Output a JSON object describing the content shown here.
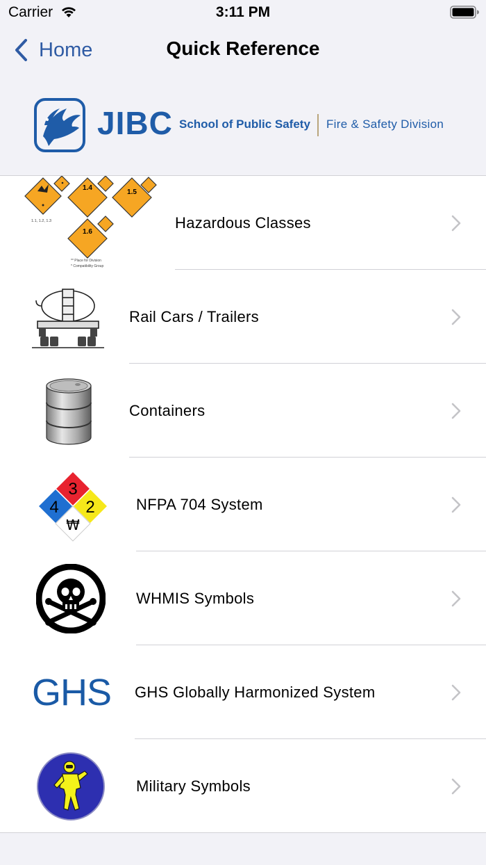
{
  "status_bar": {
    "carrier": "Carrier",
    "time": "3:11 PM"
  },
  "nav": {
    "back_label": "Home",
    "title": "Quick Reference"
  },
  "banner": {
    "logo_word": "JIBC",
    "school": "School of Public Safety",
    "division": "Fire & Safety Division"
  },
  "list": {
    "items": [
      {
        "label": "Hazardous Classes",
        "thumbnail": "explosive-placards",
        "thumb_text": {
          "p14": "1.4",
          "p15": "1.5",
          "p16": "1.6",
          "group": "1.1, 1.2, 1.3",
          "note1": "** Place for Division",
          "note2": "* Compatibility Group"
        }
      },
      {
        "label": "Rail Cars / Trailers",
        "thumbnail": "tank-trailer"
      },
      {
        "label": "Containers",
        "thumbnail": "steel-drum"
      },
      {
        "label": "NFPA 704 System",
        "thumbnail": "nfpa-diamond",
        "thumb_text": {
          "health": "4",
          "flammability": "3",
          "instability": "2",
          "special": "₩"
        }
      },
      {
        "label": "WHMIS Symbols",
        "thumbnail": "skull-crossbones"
      },
      {
        "label": "GHS Globally Harmonized System",
        "thumbnail": "ghs-text",
        "thumb_text": {
          "ghs": "GHS"
        }
      },
      {
        "label": "Military Symbols",
        "thumbnail": "hazmat-suit-person"
      }
    ]
  },
  "colors": {
    "accent": "#2f5ba4",
    "brand": "#1f5ca8",
    "background": "#f2f2f7",
    "separator": "#d1d1d6"
  }
}
